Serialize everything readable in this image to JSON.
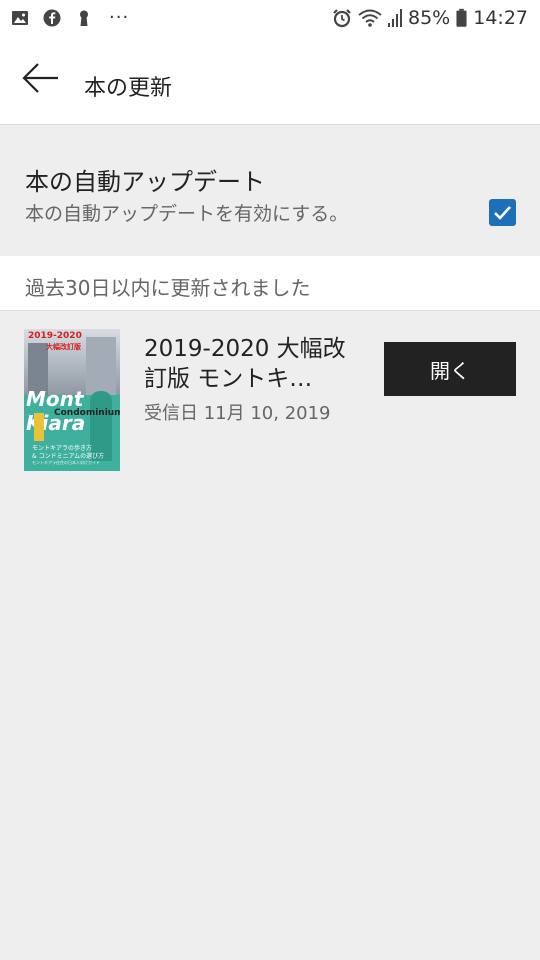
{
  "status_bar": {
    "battery": "85%",
    "time": "14:27",
    "left_icons": [
      "image-icon",
      "facebook-icon",
      "keyhole-icon",
      "more-dots-icon"
    ],
    "right_icons": [
      "alarm-icon",
      "wifi-icon",
      "signal-icon",
      "battery-icon"
    ],
    "dots": "···"
  },
  "app_bar": {
    "title": "本の更新",
    "back_icon": "back-arrow-icon"
  },
  "auto_update": {
    "title": "本の自動アップデート",
    "subtitle": "本の自動アップデートを有効にする。",
    "checked": true,
    "accent_color": "#1e6fb9"
  },
  "section": {
    "header": "過去30日以内に更新されました"
  },
  "books": [
    {
      "title": "2019-2020 大幅改訂版 モントキ…",
      "received": "受信日 11月 10, 2019",
      "open_label": "開く",
      "cover": {
        "title_text": "2019-2020",
        "subtitle_text": "大幅改訂版",
        "mont_text": "Mont Kiara",
        "condo_text": "Condominium",
        "line1": "モントキアラの歩き方",
        "line2": "& コンドミニアムの選び方",
        "line3": "モントキアラ在住の日本人向けガイド"
      }
    }
  ]
}
